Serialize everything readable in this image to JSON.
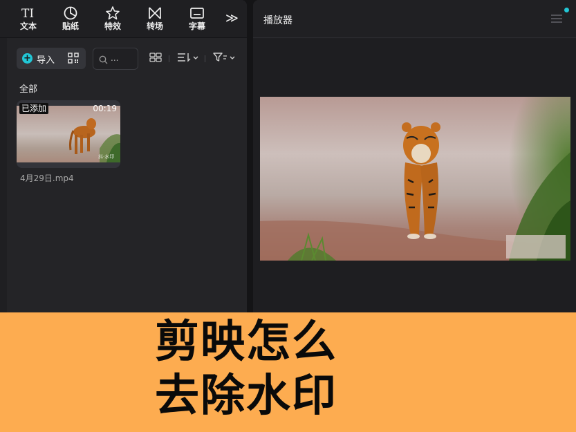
{
  "toolbar": {
    "tools": [
      {
        "label": "文本",
        "icon": "text-icon"
      },
      {
        "label": "贴纸",
        "icon": "sticker-icon"
      },
      {
        "label": "特效",
        "icon": "effects-icon"
      },
      {
        "label": "转场",
        "icon": "transition-icon"
      },
      {
        "label": "字幕",
        "icon": "subtitle-icon"
      }
    ],
    "more_label": "≫"
  },
  "media": {
    "import_label": "导入",
    "search_placeholder": "...",
    "section_label": "全部",
    "clips": [
      {
        "name": "4月29日.mp4",
        "badge": "已添加",
        "duration": "00:19"
      }
    ]
  },
  "player": {
    "title": "播放器"
  },
  "banner": {
    "line1": "剪映怎么",
    "line2": "去除水印"
  },
  "colors": {
    "accent": "#22c7d6",
    "banner": "#fdac50",
    "panel": "#242427"
  }
}
